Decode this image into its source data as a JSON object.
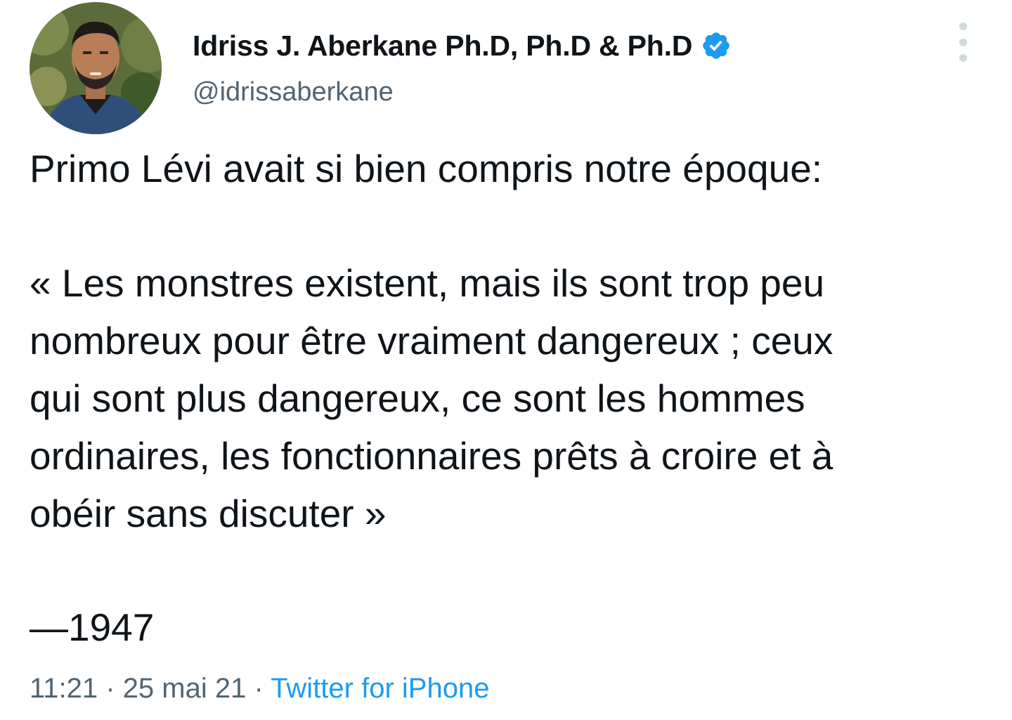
{
  "author": {
    "display_name": "Idriss J. Aberkane Ph.D, Ph.D & Ph.D",
    "handle": "@idrissaberkane",
    "verified": true,
    "verified_color": "#1d9bf0"
  },
  "tweet": {
    "intro": "Primo Lévi avait si bien compris notre époque:",
    "quote_lines": [
      "«  Les monstres existent, mais ils sont trop peu",
      "nombreux pour être vraiment dangereux ; ceux",
      "qui sont plus dangereux, ce sont les hommes",
      "ordinaires, les fonctionnaires prêts à croire et à",
      "obéir sans discuter »"
    ],
    "signature": "—1947"
  },
  "meta": {
    "time": "11:21",
    "separator": " · ",
    "date": "25 mai 21",
    "source": "Twitter for iPhone",
    "source_color": "#1d9bf0"
  },
  "icons": {
    "more": "more-vertical-icon",
    "verified": "verified-badge-icon"
  }
}
